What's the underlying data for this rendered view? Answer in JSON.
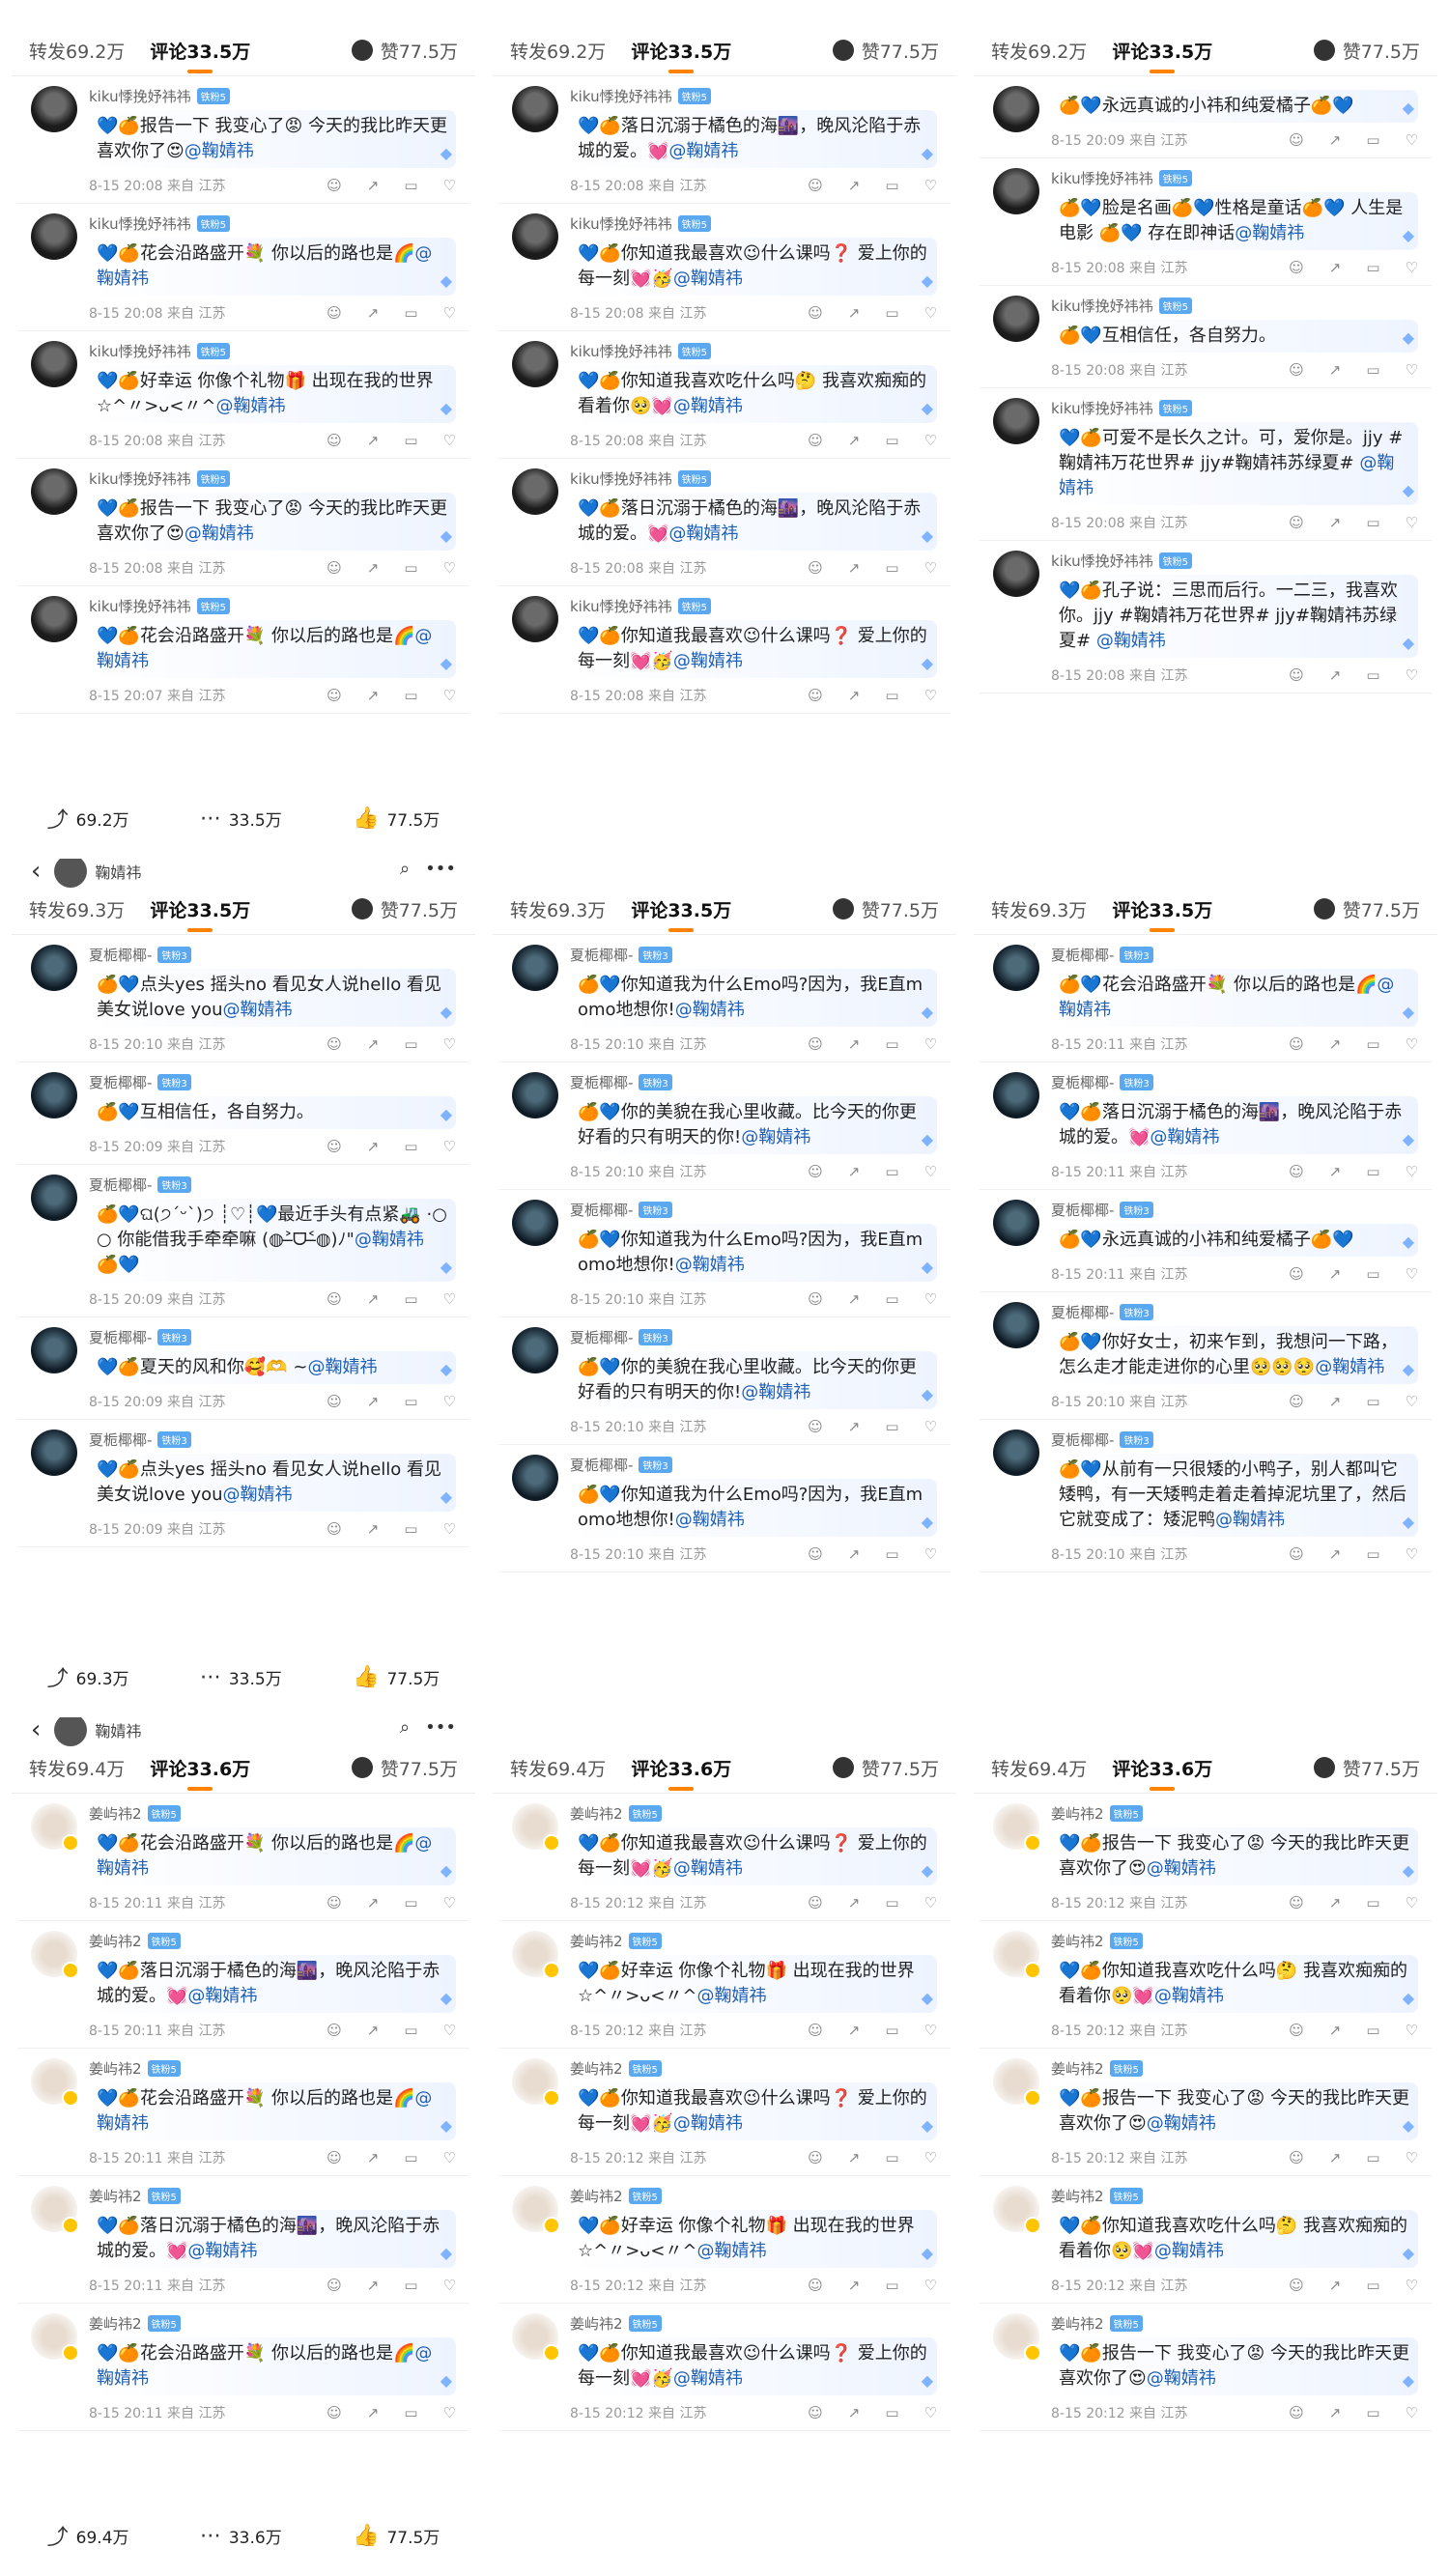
{
  "panels": [
    {
      "id": "p1",
      "stats": {
        "reposts": "转发69.2万",
        "comments": "评论33.5万",
        "likes": "赞77.5万"
      },
      "top": {
        "title": "",
        "show_bar": false
      },
      "bottom": {
        "reposts": "69.2万",
        "comments": "33.5万",
        "likes": "77.5万"
      },
      "comments": [
        {
          "user": "kiku悸挽妤祎祎",
          "badge": "铁粉5",
          "text": "💙🍊报告一下 我变心了😡 今天的我比昨天更喜欢你了😍",
          "mention": "@鞠婧祎",
          "time": "8-15 20:08  来自 江苏",
          "avatar": "dark"
        },
        {
          "user": "kiku悸挽妤祎祎",
          "badge": "铁粉5",
          "text": "💙🍊花会沿路盛开💐 你以后的路也是🌈",
          "mention": "@鞠婧祎",
          "time": "8-15 20:08  来自 江苏",
          "avatar": "dark"
        },
        {
          "user": "kiku悸挽妤祎祎",
          "badge": "铁粉5",
          "text": "💙🍊好幸运 你像个礼物🎁 出现在我的世界☆^〃>ᴗ<〃^",
          "mention": "@鞠婧祎",
          "time": "8-15 20:08  来自 江苏",
          "avatar": "dark"
        },
        {
          "user": "kiku悸挽妤祎祎",
          "badge": "铁粉5",
          "text": "💙🍊报告一下 我变心了😡 今天的我比昨天更喜欢你了😍",
          "mention": "@鞠婧祎",
          "time": "8-15 20:08  来自 江苏",
          "avatar": "dark"
        },
        {
          "user": "kiku悸挽妤祎祎",
          "badge": "铁粉5",
          "text": "💙🍊花会沿路盛开💐 你以后的路也是🌈",
          "mention": "@鞠婧祎",
          "time": "8-15 20:07  来自 江苏",
          "avatar": "dark"
        }
      ]
    },
    {
      "id": "p2",
      "stats": {
        "reposts": "转发69.2万",
        "comments": "评论33.5万",
        "likes": "赞77.5万"
      },
      "top": {
        "title": "",
        "show_bar": false
      },
      "bottom": null,
      "comments": [
        {
          "user": "kiku悸挽妤祎祎",
          "badge": "铁粉5",
          "text": "💙🍊落日沉溺于橘色的海🌆，晚风沦陷于赤城的爱。💓",
          "mention": "@鞠婧祎",
          "time": "8-15 20:08  来自 江苏",
          "avatar": "dark"
        },
        {
          "user": "kiku悸挽妤祎祎",
          "badge": "铁粉5",
          "text": "💙🍊你知道我最喜欢😉什么课吗❓ 爱上你的每一刻💓🥳",
          "mention": "@鞠婧祎",
          "time": "8-15 20:08  来自 江苏",
          "avatar": "dark"
        },
        {
          "user": "kiku悸挽妤祎祎",
          "badge": "铁粉5",
          "text": "💙🍊你知道我喜欢吃什么吗🤔 我喜欢痴痴的看着你🥺💓",
          "mention": "@鞠婧祎",
          "time": "8-15 20:08  来自 江苏",
          "avatar": "dark"
        },
        {
          "user": "kiku悸挽妤祎祎",
          "badge": "铁粉5",
          "text": "💙🍊落日沉溺于橘色的海🌆，晚风沦陷于赤城的爱。💓",
          "mention": "@鞠婧祎",
          "time": "8-15 20:08  来自 江苏",
          "avatar": "dark"
        },
        {
          "user": "kiku悸挽妤祎祎",
          "badge": "铁粉5",
          "text": "💙🍊你知道我最喜欢😉什么课吗❓ 爱上你的每一刻💓🥳",
          "mention": "@鞠婧祎",
          "time": "8-15 20:08  来自 江苏",
          "avatar": "dark"
        }
      ]
    },
    {
      "id": "p3",
      "stats": {
        "reposts": "转发69.2万",
        "comments": "评论33.5万",
        "likes": "赞77.5万"
      },
      "top": {
        "title": "",
        "show_bar": false
      },
      "bottom": null,
      "comments": [
        {
          "user": "",
          "badge": "",
          "text": "🍊💙永远真诚的小祎和纯爱橘子🍊💙",
          "mention": "",
          "time": "8-15 20:09  来自 江苏",
          "avatar": "dark"
        },
        {
          "user": "kiku悸挽妤祎祎",
          "badge": "铁粉5",
          "text": "🍊💙脸是名画🍊💙性格是童话🍊💙 人生是电影 🍊💙 存在即神话",
          "mention": "@鞠婧祎",
          "time": "8-15 20:08  来自 江苏",
          "avatar": "dark"
        },
        {
          "user": "kiku悸挽妤祎祎",
          "badge": "铁粉5",
          "text": "🍊💙互相信任，各自努力。",
          "mention": "",
          "time": "8-15 20:08  来自 江苏",
          "avatar": "dark"
        },
        {
          "user": "kiku悸挽妤祎祎",
          "badge": "铁粉5",
          "text": "💙🍊可爱不是长久之计。可，爱你是。jjy #鞠婧祎万花世界# jjy#鞠婧祎苏绿夏# ",
          "mention": "@鞠婧祎",
          "time": "8-15 20:08  来自 江苏",
          "avatar": "dark"
        },
        {
          "user": "kiku悸挽妤祎祎",
          "badge": "铁粉5",
          "text": "💙🍊孔子说：三思而后行。一二三，我喜欢你。jjy #鞠婧祎万花世界# jjy#鞠婧祎苏绿夏# ",
          "mention": "@鞠婧祎",
          "time": "8-15 20:08  来自 江苏",
          "avatar": "dark"
        }
      ]
    },
    {
      "id": "p4",
      "stats": {
        "reposts": "转发69.3万",
        "comments": "评论33.5万",
        "likes": "赞77.5万"
      },
      "top": {
        "title": "鞠婧祎",
        "show_bar": true
      },
      "bottom": {
        "reposts": "69.3万",
        "comments": "33.5万",
        "likes": "77.5万"
      },
      "comments": [
        {
          "user": "夏栀椰椰-",
          "badge": "铁粉3",
          "text": "🍊💙点头yes 摇头no 看见女人说hello 看见美女说love you",
          "mention": "@鞠婧祎",
          "time": "8-15 20:10  来自 江苏",
          "avatar": "night"
        },
        {
          "user": "夏栀椰椰-",
          "badge": "铁粉3",
          "text": "🍊💙互相信任，各自努力。",
          "mention": "",
          "time": "8-15 20:09  来自 江苏",
          "avatar": "night"
        },
        {
          "user": "夏栀椰椰-",
          "badge": "铁粉3",
          "text": "🍊💙ଘ(੭ˊᵕˋ)੭ ┊♡┊💙最近手头有点紧🚜 ·○○ 你能借我手牵牵嘛 (◍˃̶ᗜ˂̶◍)ﾉ\"",
          "mention": "@鞠婧祎 🍊💙",
          "time": "8-15 20:09  来自 江苏",
          "avatar": "night"
        },
        {
          "user": "夏栀椰椰-",
          "badge": "铁粉3",
          "text": "💙🍊夏天的风和你🥰🫶 ~",
          "mention": "@鞠婧祎",
          "time": "8-15 20:09  来自 江苏",
          "avatar": "night"
        },
        {
          "user": "夏栀椰椰-",
          "badge": "铁粉3",
          "text": "💙🍊点头yes 摇头no 看见女人说hello 看见美女说love you",
          "mention": "@鞠婧祎",
          "time": "8-15 20:09  来自 江苏",
          "avatar": "night"
        }
      ]
    },
    {
      "id": "p5",
      "stats": {
        "reposts": "转发69.3万",
        "comments": "评论33.5万",
        "likes": "赞77.5万"
      },
      "top": {
        "title": "",
        "show_bar": false
      },
      "bottom": null,
      "comments": [
        {
          "user": "夏栀椰椰-",
          "badge": "铁粉3",
          "text": "🍊💙你知道我为什么Emo吗?因为，我E直momo地想你!",
          "mention": "@鞠婧祎",
          "time": "8-15 20:10  来自 江苏",
          "avatar": "night"
        },
        {
          "user": "夏栀椰椰-",
          "badge": "铁粉3",
          "text": "🍊💙你的美貌在我心里收藏。比今天的你更好看的只有明天的你!",
          "mention": "@鞠婧祎",
          "time": "8-15 20:10  来自 江苏",
          "avatar": "night"
        },
        {
          "user": "夏栀椰椰-",
          "badge": "铁粉3",
          "text": "🍊💙你知道我为什么Emo吗?因为，我E直momo地想你!",
          "mention": "@鞠婧祎",
          "time": "8-15 20:10  来自 江苏",
          "avatar": "night"
        },
        {
          "user": "夏栀椰椰-",
          "badge": "铁粉3",
          "text": "🍊💙你的美貌在我心里收藏。比今天的你更好看的只有明天的你!",
          "mention": "@鞠婧祎",
          "time": "8-15 20:10  来自 江苏",
          "avatar": "night"
        },
        {
          "user": "夏栀椰椰-",
          "badge": "铁粉3",
          "text": "🍊💙你知道我为什么Emo吗?因为，我E直momo地想你!",
          "mention": "@鞠婧祎",
          "time": "8-15 20:10  来自 江苏",
          "avatar": "night"
        }
      ]
    },
    {
      "id": "p6",
      "stats": {
        "reposts": "转发69.3万",
        "comments": "评论33.5万",
        "likes": "赞77.5万"
      },
      "top": {
        "title": "",
        "show_bar": false
      },
      "bottom": null,
      "comments": [
        {
          "user": "夏栀椰椰-",
          "badge": "铁粉3",
          "text": "🍊💙花会沿路盛开💐 你以后的路也是🌈",
          "mention": "@鞠婧祎",
          "time": "8-15 20:11  来自 江苏",
          "avatar": "night"
        },
        {
          "user": "夏栀椰椰-",
          "badge": "铁粉3",
          "text": "💙🍊落日沉溺于橘色的海🌆，晚风沦陷于赤城的爱。💓",
          "mention": "@鞠婧祎",
          "time": "8-15 20:11  来自 江苏",
          "avatar": "night"
        },
        {
          "user": "夏栀椰椰-",
          "badge": "铁粉3",
          "text": "🍊💙永远真诚的小祎和纯爱橘子🍊💙",
          "mention": "",
          "time": "8-15 20:11  来自 江苏",
          "avatar": "night"
        },
        {
          "user": "夏栀椰椰-",
          "badge": "铁粉3",
          "text": "🍊💙你好女士，初来乍到，我想问一下路，怎么走才能走进你的心里🥺🥺🥺",
          "mention": "@鞠婧祎",
          "time": "8-15 20:10  来自 江苏",
          "avatar": "night"
        },
        {
          "user": "夏栀椰椰-",
          "badge": "铁粉3",
          "text": "🍊💙从前有一只很矮的小鸭子，别人都叫它矮鸭，有一天矮鸭走着走着掉泥坑里了，然后它就变成了：矮泥鸭",
          "mention": "@鞠婧祎",
          "time": "8-15 20:10  来自 江苏",
          "avatar": "night"
        }
      ]
    },
    {
      "id": "p7",
      "stats": {
        "reposts": "转发69.4万",
        "comments": "评论33.6万",
        "likes": "赞77.5万"
      },
      "top": {
        "title": "鞠婧祎",
        "show_bar": true
      },
      "bottom": {
        "reposts": "69.4万",
        "comments": "33.6万",
        "likes": "77.5万"
      },
      "comments": [
        {
          "user": "姜屿祎2",
          "badge": "铁粉5",
          "text": "💙🍊花会沿路盛开💐 你以后的路也是🌈",
          "mention": "@鞠婧祎",
          "time": "8-15 20:11  来自 江苏",
          "avatar": "light"
        },
        {
          "user": "姜屿祎2",
          "badge": "铁粉5",
          "text": "💙🍊落日沉溺于橘色的海🌆，晚风沦陷于赤城的爱。💓",
          "mention": "@鞠婧祎",
          "time": "8-15 20:11  来自 江苏",
          "avatar": "light"
        },
        {
          "user": "姜屿祎2",
          "badge": "铁粉5",
          "text": "💙🍊花会沿路盛开💐 你以后的路也是🌈",
          "mention": "@鞠婧祎",
          "time": "8-15 20:11  来自 江苏",
          "avatar": "light"
        },
        {
          "user": "姜屿祎2",
          "badge": "铁粉5",
          "text": "💙🍊落日沉溺于橘色的海🌆，晚风沦陷于赤城的爱。💓",
          "mention": "@鞠婧祎",
          "time": "8-15 20:11  来自 江苏",
          "avatar": "light"
        },
        {
          "user": "姜屿祎2",
          "badge": "铁粉5",
          "text": "💙🍊花会沿路盛开💐 你以后的路也是🌈",
          "mention": "@鞠婧祎",
          "time": "8-15 20:11  来自 江苏",
          "avatar": "light"
        }
      ]
    },
    {
      "id": "p8",
      "stats": {
        "reposts": "转发69.4万",
        "comments": "评论33.6万",
        "likes": "赞77.5万"
      },
      "top": {
        "title": "",
        "show_bar": false
      },
      "bottom": null,
      "comments": [
        {
          "user": "姜屿祎2",
          "badge": "铁粉5",
          "text": "💙🍊你知道我最喜欢😉什么课吗❓ 爱上你的每一刻💓🥳",
          "mention": "@鞠婧祎",
          "time": "8-15 20:12  来自 江苏",
          "avatar": "light"
        },
        {
          "user": "姜屿祎2",
          "badge": "铁粉5",
          "text": "💙🍊好幸运 你像个礼物🎁 出现在我的世界☆^〃>ᴗ<〃^",
          "mention": "@鞠婧祎",
          "time": "8-15 20:12  来自 江苏",
          "avatar": "light"
        },
        {
          "user": "姜屿祎2",
          "badge": "铁粉5",
          "text": "💙🍊你知道我最喜欢😉什么课吗❓ 爱上你的每一刻💓🥳",
          "mention": "@鞠婧祎",
          "time": "8-15 20:12  来自 江苏",
          "avatar": "light"
        },
        {
          "user": "姜屿祎2",
          "badge": "铁粉5",
          "text": "💙🍊好幸运 你像个礼物🎁 出现在我的世界☆^〃>ᴗ<〃^",
          "mention": "@鞠婧祎",
          "time": "8-15 20:12  来自 江苏",
          "avatar": "light"
        },
        {
          "user": "姜屿祎2",
          "badge": "铁粉5",
          "text": "💙🍊你知道我最喜欢😉什么课吗❓ 爱上你的每一刻💓🥳",
          "mention": "@鞠婧祎",
          "time": "8-15 20:12  来自 江苏",
          "avatar": "light"
        }
      ]
    },
    {
      "id": "p9",
      "stats": {
        "reposts": "转发69.4万",
        "comments": "评论33.6万",
        "likes": "赞77.5万"
      },
      "top": {
        "title": "",
        "show_bar": false
      },
      "bottom": null,
      "comments": [
        {
          "user": "姜屿祎2",
          "badge": "铁粉5",
          "text": "💙🍊报告一下 我变心了😡 今天的我比昨天更喜欢你了😍",
          "mention": "@鞠婧祎",
          "time": "8-15 20:12  来自 江苏",
          "avatar": "light"
        },
        {
          "user": "姜屿祎2",
          "badge": "铁粉5",
          "text": "💙🍊你知道我喜欢吃什么吗🤔 我喜欢痴痴的看着你🥺💓",
          "mention": "@鞠婧祎",
          "time": "8-15 20:12  来自 江苏",
          "avatar": "light"
        },
        {
          "user": "姜屿祎2",
          "badge": "铁粉5",
          "text": "💙🍊报告一下 我变心了😡 今天的我比昨天更喜欢你了😍",
          "mention": "@鞠婧祎",
          "time": "8-15 20:12  来自 江苏",
          "avatar": "light"
        },
        {
          "user": "姜屿祎2",
          "badge": "铁粉5",
          "text": "💙🍊你知道我喜欢吃什么吗🤔 我喜欢痴痴的看着你🥺💓",
          "mention": "@鞠婧祎",
          "time": "8-15 20:12  来自 江苏",
          "avatar": "light"
        },
        {
          "user": "姜屿祎2",
          "badge": "铁粉5",
          "text": "💙🍊报告一下 我变心了😡 今天的我比昨天更喜欢你了😍",
          "mention": "@鞠婧祎",
          "time": "8-15 20:12  来自 江苏",
          "avatar": "light"
        }
      ]
    }
  ]
}
